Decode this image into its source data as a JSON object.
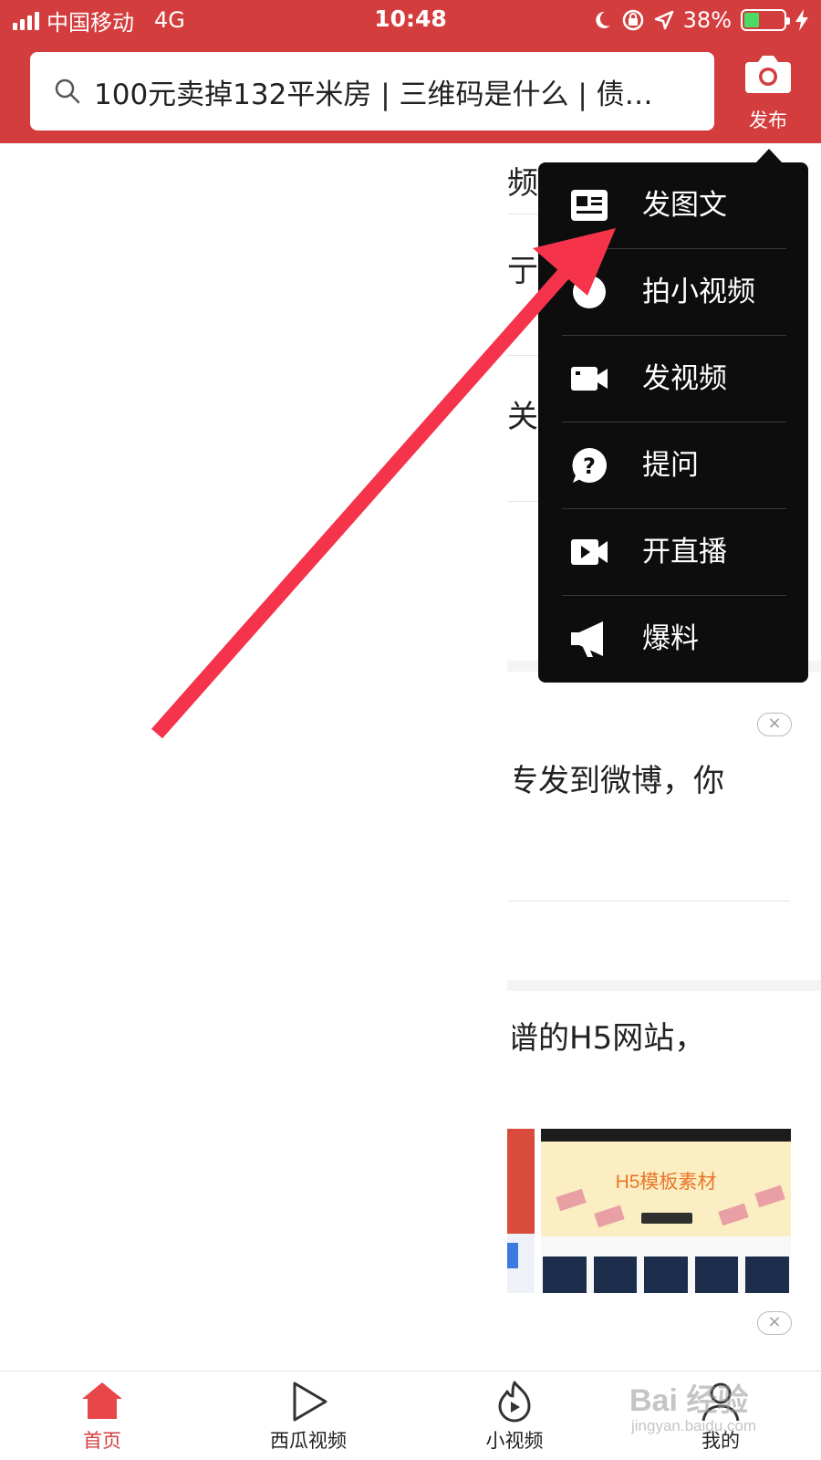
{
  "status_bar": {
    "carrier": "中国移动",
    "network": "4G",
    "time": "10:48",
    "battery_percent": "38%",
    "battery_level": 0.38,
    "icons": [
      "signal-icon",
      "moon-icon",
      "rotation-lock-icon",
      "location-arrow-icon",
      "battery-icon",
      "charging-bolt-icon"
    ]
  },
  "header": {
    "search_text": "100元卖掉132平米房 | 三维码是什么 | 债…",
    "publish_label": "发布"
  },
  "feed": {
    "fragments": [
      "频",
      "亍D",
      "关合",
      "专发到微博，你",
      "谱的H5网站，"
    ],
    "close_label": "×",
    "thumbnail_banner_title": "H5模板素材"
  },
  "publish_menu": {
    "items": [
      {
        "label": "发图文",
        "icon": "article-icon"
      },
      {
        "label": "拍小视频",
        "icon": "circle-icon"
      },
      {
        "label": "发视频",
        "icon": "video-camera-icon"
      },
      {
        "label": "提问",
        "icon": "question-bubble-icon"
      },
      {
        "label": "开直播",
        "icon": "live-play-icon"
      },
      {
        "label": "爆料",
        "icon": "megaphone-icon"
      }
    ]
  },
  "tabbar": {
    "tabs": [
      {
        "label": "首页",
        "icon": "home-icon",
        "active": true
      },
      {
        "label": "西瓜视频",
        "icon": "play-icon",
        "active": false
      },
      {
        "label": "小视频",
        "icon": "flame-play-icon",
        "active": false
      },
      {
        "label": "我的",
        "icon": "person-icon",
        "active": false
      }
    ]
  },
  "watermark": {
    "brand": "Bai 经验",
    "url": "jingyan.baidu.com"
  },
  "colors": {
    "brand_red": "#d43d3d",
    "menu_background": "#0d0d0d",
    "arrow_red": "#f5334a",
    "battery_green": "#4cd964"
  }
}
